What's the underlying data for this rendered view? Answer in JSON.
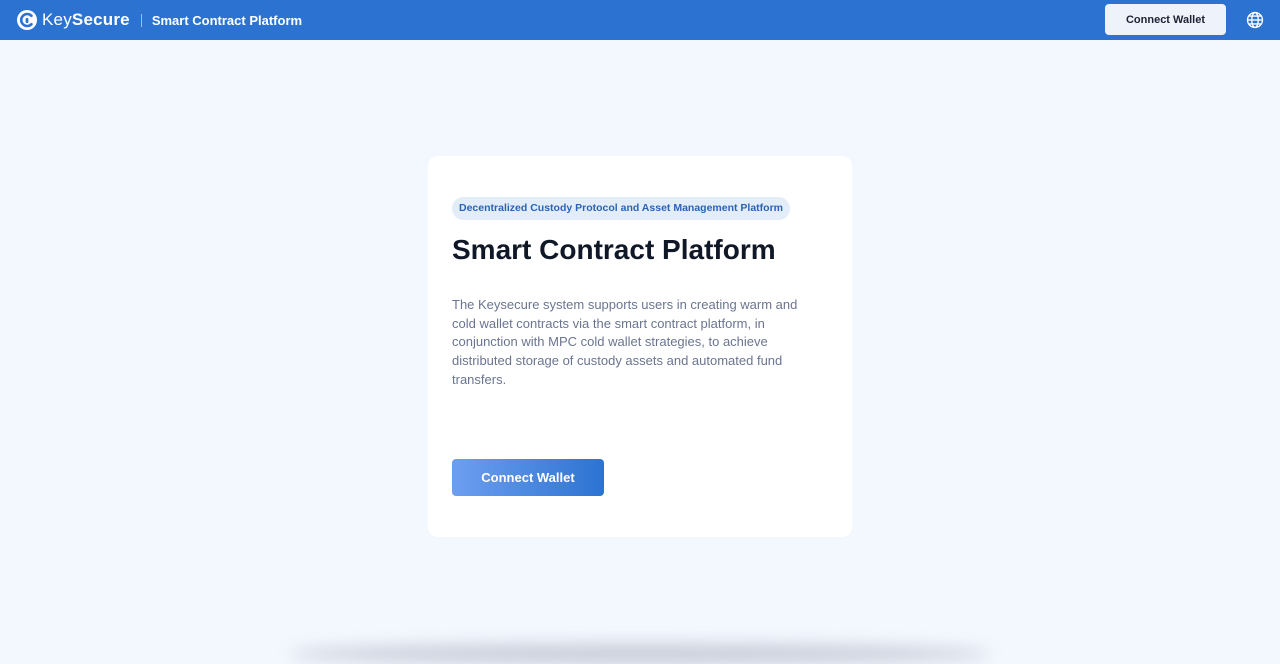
{
  "header": {
    "brand_prefix": "Key",
    "brand_suffix": "Secure",
    "subtitle": "Smart Contract Platform",
    "connect_label": "Connect Wallet",
    "logo_icon": "keysecure-logo-icon",
    "language_icon": "globe-icon",
    "bar_color": "#2c73d1"
  },
  "card": {
    "tag": "Decentralized Custody Protocol and Asset Management Platform",
    "title": "Smart Contract Platform",
    "description": "The Keysecure system supports users in creating warm and cold wallet contracts via the smart contract platform, in conjunction with MPC cold wallet strategies, to achieve distributed storage of custody assets and automated fund transfers.",
    "connect_label": "Connect Wallet"
  }
}
